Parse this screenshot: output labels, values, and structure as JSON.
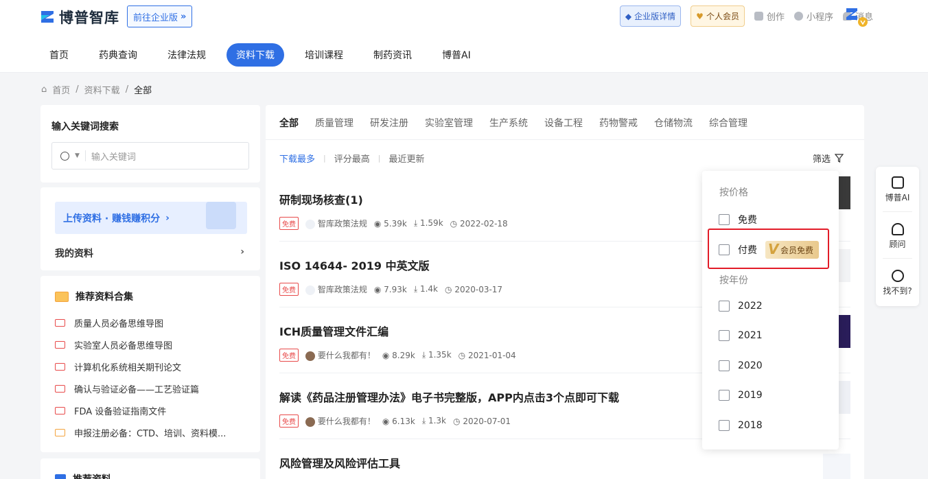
{
  "header": {
    "logo_text": "博普智库",
    "enterprise_link": "前往企业版",
    "enterprise_detail": "企业版详情",
    "personal_vip": "个人会员",
    "links": [
      "创作",
      "小程序",
      "消息"
    ]
  },
  "nav": {
    "items": [
      "首页",
      "药典查询",
      "法律法规",
      "资料下载",
      "培训课程",
      "制药资讯",
      "博普AI"
    ],
    "active": "资料下载"
  },
  "breadcrumb": {
    "items": [
      "首页",
      "资料下载",
      "全部"
    ],
    "separator": "/"
  },
  "sidebar": {
    "search_title": "输入关键词搜索",
    "search_placeholder": "输入关键词",
    "upload_label": "上传资料 · 赚钱赚积分",
    "my_resources": "我的资料",
    "recommend_title": "推荐资料合集",
    "recommend_items": [
      "质量人员必备思维导图",
      "实验室人员必备思维导图",
      "计算机化系统相关期刊论文",
      "确认与验证必备——工艺验证篇",
      "FDA 设备验证指南文件",
      "申报注册必备：CTD、培训、资料模..."
    ],
    "bottom_title": "推荐资料"
  },
  "main": {
    "tabs": [
      "全部",
      "质量管理",
      "研发注册",
      "实验室管理",
      "生产系统",
      "设备工程",
      "药物警戒",
      "仓储物流",
      "综合管理"
    ],
    "sorts": [
      "下载最多",
      "评分最高",
      "最近更新"
    ],
    "filter_label": "筛选",
    "items": [
      {
        "title": "研制现场核查(1)",
        "tag": "免费",
        "author": "智库政策法规",
        "views": "5.39k",
        "downloads": "1.59k",
        "date": "2022-02-18"
      },
      {
        "title": "ISO 14644- 2019 中英文版",
        "tag": "免费",
        "author": "智库政策法规",
        "views": "7.93k",
        "downloads": "1.4k",
        "date": "2020-03-17"
      },
      {
        "title": "ICH质量管理文件汇编",
        "tag": "免费",
        "author": "要什么我都有！",
        "views": "8.29k",
        "downloads": "1.35k",
        "date": "2021-01-04"
      },
      {
        "title": "解读《药品注册管理办法》电子书完整版，APP内点击3个点即可下载",
        "tag": "免费",
        "author": "要什么我都有！",
        "views": "6.13k",
        "downloads": "1.3k",
        "date": "2020-07-01"
      },
      {
        "title": "风险管理及风险评估工具"
      }
    ]
  },
  "filter_dropdown": {
    "price_section": "按价格",
    "price_options": [
      "免费",
      "付费"
    ],
    "member_free_badge": "会员免费",
    "year_section": "按年份",
    "year_options": [
      "2022",
      "2021",
      "2020",
      "2019",
      "2018"
    ]
  },
  "side_tools": [
    "博普AI",
    "顾问",
    "找不到?"
  ]
}
